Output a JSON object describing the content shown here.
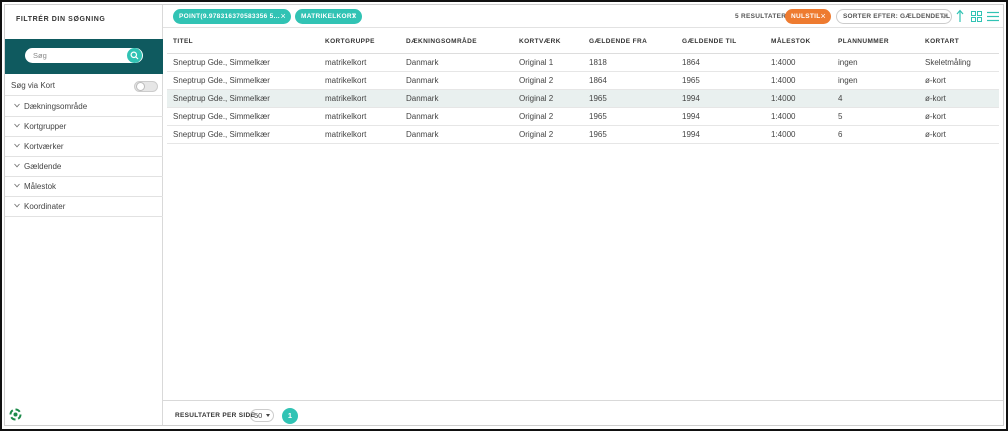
{
  "sidebar": {
    "title": "FILTRÉR DIN SØGNING",
    "search_placeholder": "Søg",
    "map_toggle_label": "Søg via Kort",
    "filters": [
      "Dækningsområde",
      "Kortgrupper",
      "Kortværker",
      "Gældende",
      "Målestok",
      "Koordinater"
    ]
  },
  "toolbar": {
    "chips": [
      {
        "label": "POINT(9.978316370583356 5..."
      },
      {
        "label": "MATRIKELKORT"
      }
    ],
    "results_count": "5 RESULTATER",
    "reset_label": "NULSTIL",
    "sort_label": "SORTER EFTER: GÆLDENDETIL"
  },
  "table": {
    "columns": [
      "TITEL",
      "KORTGRUPPE",
      "DÆKNINGSOMRÅDE",
      "KORTVÆRK",
      "GÆLDENDE FRA",
      "GÆLDENDE TIL",
      "MÅLESTOK",
      "PLANNUMMER",
      "KORTART"
    ],
    "rows": [
      [
        "Sneptrup Gde., Simmelkær",
        "matrikelkort",
        "Danmark",
        "Original 1",
        "1818",
        "1864",
        "1:4000",
        "ingen",
        "Skeletmåling"
      ],
      [
        "Sneptrup Gde., Simmelkær",
        "matrikelkort",
        "Danmark",
        "Original 2",
        "1864",
        "1965",
        "1:4000",
        "ingen",
        "ø-kort"
      ],
      [
        "Sneptrup Gde., Simmelkær",
        "matrikelkort",
        "Danmark",
        "Original 2",
        "1965",
        "1994",
        "1:4000",
        "4",
        "ø-kort"
      ],
      [
        "Sneptrup Gde., Simmelkær",
        "matrikelkort",
        "Danmark",
        "Original 2",
        "1965",
        "1994",
        "1:4000",
        "5",
        "ø-kort"
      ],
      [
        "Sneptrup Gde., Simmelkær",
        "matrikelkort",
        "Danmark",
        "Original 2",
        "1965",
        "1994",
        "1:4000",
        "6",
        "ø-kort"
      ]
    ],
    "highlighted_row": 2
  },
  "pagination": {
    "per_page_label": "RESULTATER PER SIDE",
    "per_page_value": "50",
    "current_page": "1"
  },
  "colors": {
    "accent": "#31c3b4",
    "sidebar_header": "#0f5a5f",
    "reset": "#ee7b30",
    "row_highlight": "#e9f0ef"
  }
}
